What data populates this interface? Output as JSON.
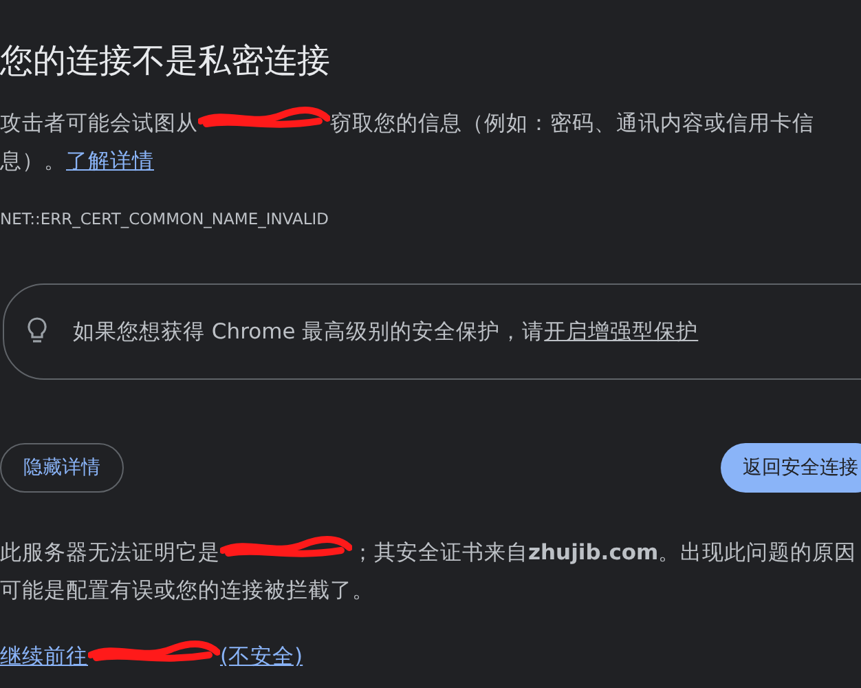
{
  "title": "您的连接不是私密连接",
  "intro": {
    "parts": [
      {
        "kind": "text",
        "text": "攻击者可能会试图从"
      },
      {
        "kind": "redacted"
      },
      {
        "kind": "text",
        "text": "窃取您的信息（例如：密码、通讯内容或信用卡信息）。"
      }
    ],
    "link": "了解详情"
  },
  "error_code": "NET::ERR_CERT_COMMON_NAME_INVALID",
  "tip": {
    "text": "如果您想获得 Chrome 最高级别的安全保护，请",
    "link": "开启增强型保护"
  },
  "buttons": [
    {
      "kind": "secondary",
      "label": "隐藏详情"
    },
    {
      "kind": "primary",
      "label": "返回安全连接"
    }
  ],
  "details": {
    "parts": [
      {
        "kind": "text",
        "text": "此服务器无法证明它是"
      },
      {
        "kind": "redacted"
      },
      {
        "kind": "text",
        "text": "；其安全证书来自**zhujib.com**。出现此问题的原因可能是配置有误或您的连接被拦截了。"
      }
    ]
  },
  "proceed_link": {
    "parts": [
      {
        "kind": "text",
        "text": "继续前往"
      },
      {
        "kind": "redacted"
      },
      {
        "kind": "text",
        "text": "(不安全)"
      }
    ]
  }
}
